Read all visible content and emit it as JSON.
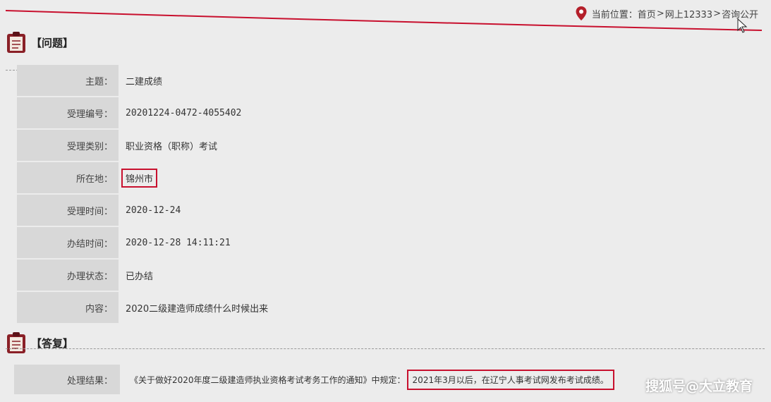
{
  "breadcrumb": {
    "prefix": "当前位置：",
    "items": [
      "首页",
      "网上12333",
      "咨询公开"
    ],
    "separator": ">"
  },
  "question_section": {
    "title": "【问题】",
    "rows": [
      {
        "label": "主题：",
        "value": "二建成绩"
      },
      {
        "label": "受理编号：",
        "value": "20201224-0472-4055402"
      },
      {
        "label": "受理类别：",
        "value": "职业资格（职称）考试"
      },
      {
        "label": "所在地：",
        "value": "锦州市"
      },
      {
        "label": "受理时间：",
        "value": "2020-12-24"
      },
      {
        "label": "办结时间：",
        "value": "2020-12-28 14:11:21"
      },
      {
        "label": "办理状态：",
        "value": "已办结"
      },
      {
        "label": "内容：",
        "value": "2020二级建造师成绩什么时候出来"
      }
    ]
  },
  "answer_section": {
    "title": "【答复】",
    "label": "处理结果：",
    "value_prefix": "《关于做好2020年度二级建造师执业资格考试考务工作的通知》中规定：",
    "value_highlight": "2021年3月以后，在辽宁人事考试网发布考试成绩。"
  },
  "watermark": "搜狐号@大立教育",
  "colors": {
    "accent": "#c8102e",
    "label_bg": "#d8d8d8",
    "page_bg": "#ececec"
  }
}
